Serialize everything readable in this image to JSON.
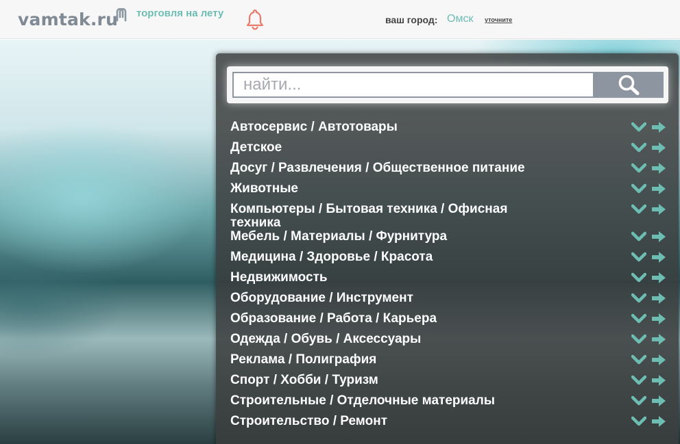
{
  "header": {
    "logo": "vamtak.ru",
    "tagline": "торговля на лету",
    "city_label": "ваш город:",
    "city": "Омск",
    "city_change": "уточните"
  },
  "search": {
    "placeholder": "найти..."
  },
  "categories": [
    {
      "label": "Автосервис / Автотовары"
    },
    {
      "label": "Детское"
    },
    {
      "label": "Досуг / Развлечения / Общественное питание"
    },
    {
      "label": "Животные"
    },
    {
      "label": "Компьютеры / Бытовая техника / Офисная техника"
    },
    {
      "label": "Мебель / Материалы / Фурнитура"
    },
    {
      "label": "Медицина / Здоровье / Красота"
    },
    {
      "label": "Недвижимость"
    },
    {
      "label": "Оборудование / Инструмент"
    },
    {
      "label": "Образование / Работа / Карьера"
    },
    {
      "label": "Одежда / Обувь / Аксессуары"
    },
    {
      "label": "Реклама / Полиграфия"
    },
    {
      "label": "Спорт / Хобби / Туризм"
    },
    {
      "label": "Строительные / Отделочные материалы"
    },
    {
      "label": "Строительство / Ремонт"
    }
  ],
  "colors": {
    "accent": "#6dbdb3",
    "bell": "#e87a6a",
    "panel": "#3a3c3c",
    "search_button": "#8d96a0"
  },
  "icons": {
    "logo": "link-icon",
    "notifications": "bell-icon",
    "search": "magnifier-icon",
    "expand": "chevron-down-icon",
    "open": "arrow-right-icon"
  }
}
